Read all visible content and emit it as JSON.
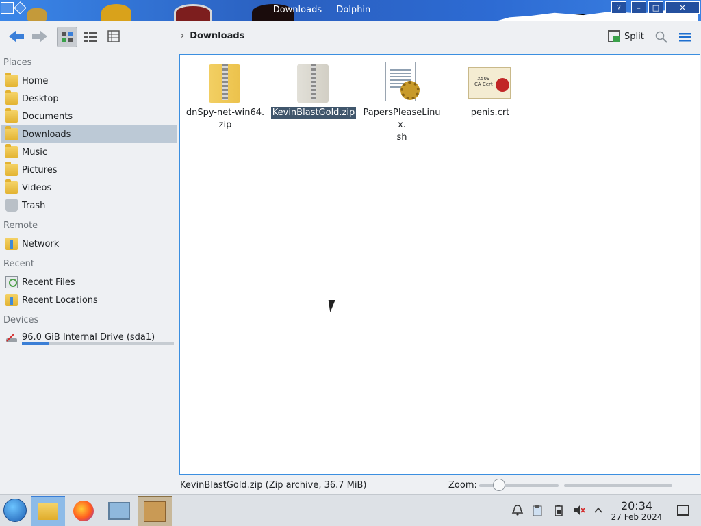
{
  "window": {
    "title": "Downloads — Dolphin",
    "help_label": "?",
    "minimize_label": "–",
    "maximize_label": "□",
    "close_label": "✕"
  },
  "toolbar": {
    "breadcrumb_chevron": "›",
    "location": "Downloads",
    "split_label": "Split",
    "search_icon": "search-icon",
    "menu_icon": "hamburger-menu-icon"
  },
  "sidebar": {
    "sections": {
      "places": "Places",
      "remote": "Remote",
      "recent": "Recent",
      "devices": "Devices"
    },
    "places": [
      {
        "label": "Home",
        "icon": "home-folder-icon"
      },
      {
        "label": "Desktop",
        "icon": "desktop-folder-icon"
      },
      {
        "label": "Documents",
        "icon": "documents-folder-icon"
      },
      {
        "label": "Downloads",
        "icon": "downloads-folder-icon",
        "active": true
      },
      {
        "label": "Music",
        "icon": "music-folder-icon"
      },
      {
        "label": "Pictures",
        "icon": "pictures-folder-icon"
      },
      {
        "label": "Videos",
        "icon": "videos-folder-icon"
      },
      {
        "label": "Trash",
        "icon": "trash-icon"
      }
    ],
    "remote": [
      {
        "label": "Network",
        "icon": "network-folder-icon"
      }
    ],
    "recent": [
      {
        "label": "Recent Files",
        "icon": "recent-files-icon"
      },
      {
        "label": "Recent Locations",
        "icon": "recent-locations-icon"
      }
    ],
    "devices": [
      {
        "label": "96.0 GiB Internal Drive (sda1)",
        "icon": "hard-drive-icon",
        "usage": 0.18
      }
    ]
  },
  "files": [
    {
      "name": "dnSpy-net-win64.zip",
      "line1": "dnSpy-net-win64.",
      "line2": "zip",
      "icon": "zip-archive-icon"
    },
    {
      "name": "KevinBlastGold.zip",
      "line1": "KevinBlastGold.zip",
      "line2": "",
      "icon": "zip-archive-icon",
      "selected": true
    },
    {
      "name": "PapersPleaseLinux.sh",
      "line1": "PapersPleaseLinux.",
      "line2": "sh",
      "icon": "shell-script-icon"
    },
    {
      "name": "penis.crt",
      "line1": "penis.crt",
      "line2": "",
      "icon": "certificate-icon"
    }
  ],
  "statusbar": {
    "text": "KevinBlastGold.zip (Zip archive, 36.7 MiB)",
    "zoom_label": "Zoom:",
    "zoom_level": 0.25
  },
  "taskbar": {
    "clock_time": "20:34",
    "clock_date": "27 Feb 2024",
    "tasks": [
      "start-menu",
      "dolphin-file-manager",
      "firefox",
      "system-settings",
      "package-installer"
    ],
    "tray": [
      "notifications-icon",
      "clipboard-icon",
      "battery-icon",
      "volume-muted-icon",
      "tray-expand-icon"
    ]
  },
  "colors": {
    "accent": "#3b8fe0",
    "selection": "#40566c",
    "sidebar_active": "#bcc9d6"
  }
}
